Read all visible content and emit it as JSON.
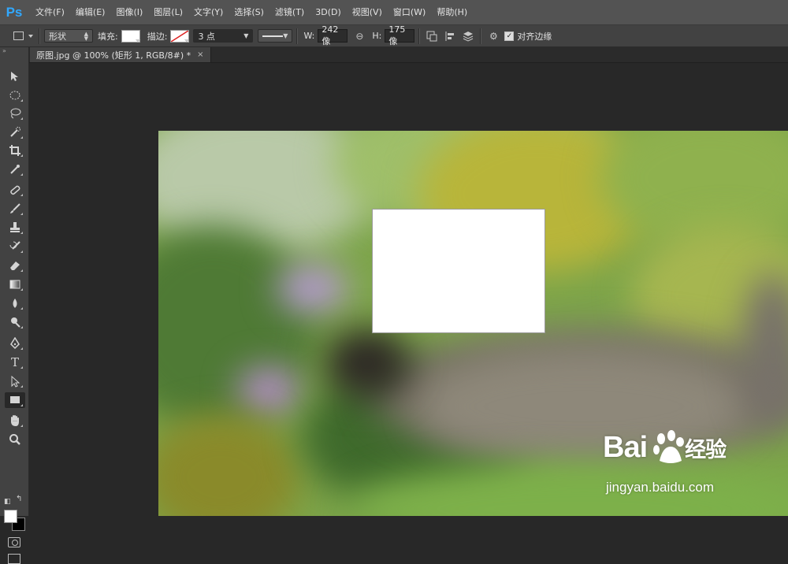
{
  "app": {
    "logo": "Ps"
  },
  "menu": {
    "items": [
      "文件(F)",
      "编辑(E)",
      "图像(I)",
      "图层(L)",
      "文字(Y)",
      "选择(S)",
      "滤镜(T)",
      "3D(D)",
      "视图(V)",
      "窗口(W)",
      "帮助(H)"
    ]
  },
  "options": {
    "mode_value": "形状",
    "fill_label": "填充:",
    "fill_color": "#ffffff",
    "stroke_label": "描边:",
    "stroke_size": "3 点",
    "width_label": "W:",
    "width_value": "242 像",
    "height_label": "H:",
    "height_value": "175 像",
    "align_edges_label": "对齐边缘",
    "align_edges_checked": true
  },
  "document": {
    "tab_title": "原图.jpg @ 100% (矩形 1, RGB/8#) *",
    "close_glyph": "×"
  },
  "toolbox": {
    "foreground_color": "#ffffff",
    "background_color": "#000000"
  },
  "watermark": {
    "brand": "Bai",
    "brand_suffix": "经验",
    "site": "jingyan.baidu.com"
  }
}
